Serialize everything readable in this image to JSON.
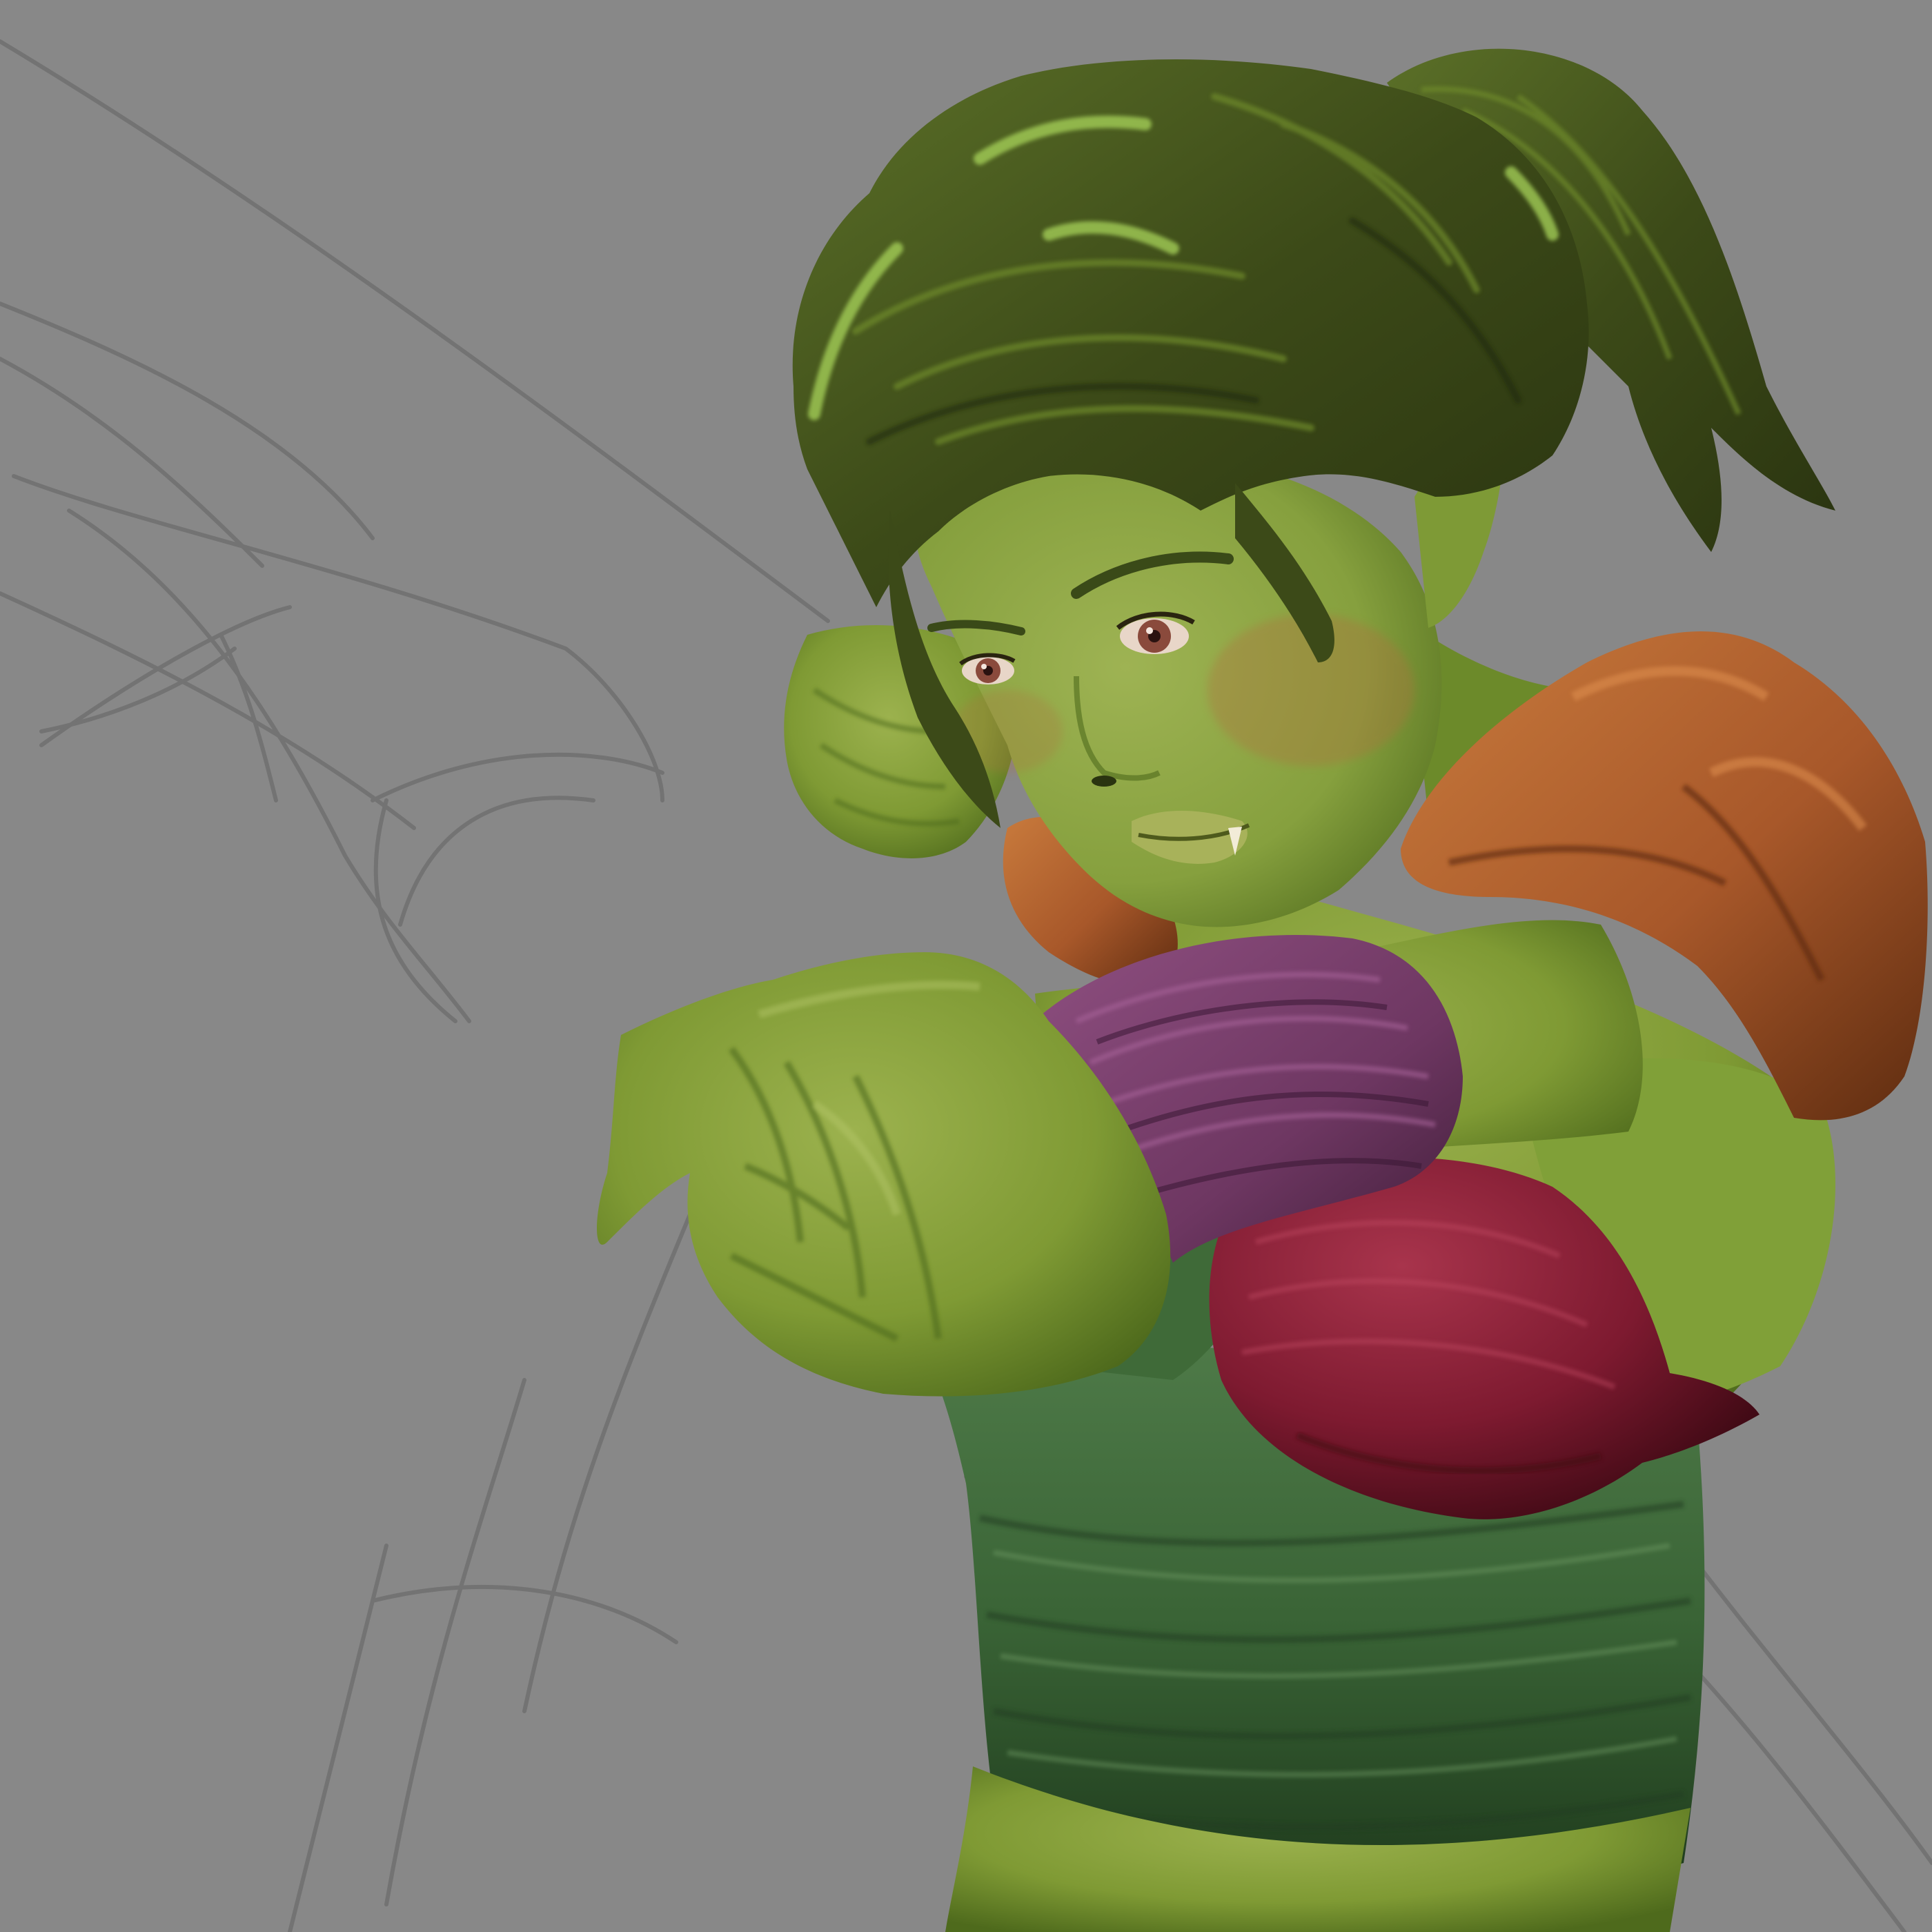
{
  "artwork": {
    "subject": "",
    "palette": {
      "background": "#888888",
      "sketch_line": "#6a6a6a",
      "skin_light": "#9cb24e",
      "skin_mid": "#7f9a34",
      "skin_dark": "#4e6a1c",
      "hair_dark": "#2f3a14",
      "hair_mid": "#4d5e22",
      "hair_highlight": "#a8d45a",
      "shoulder_leather": "#b1602a",
      "shoulder_shadow": "#6b3414",
      "wrist_wrap": "#7a3f6c",
      "wrist_wrap_shadow": "#4e2545",
      "chest_wrap": "#8a1e34",
      "chest_wrap_shadow": "#4e0e1a",
      "torso_cloth": "#3e6a3a",
      "torso_cloth_dark": "#1f3a1e",
      "eye_iris": "#8a4a3c",
      "lips": "#a8b25a"
    }
  }
}
